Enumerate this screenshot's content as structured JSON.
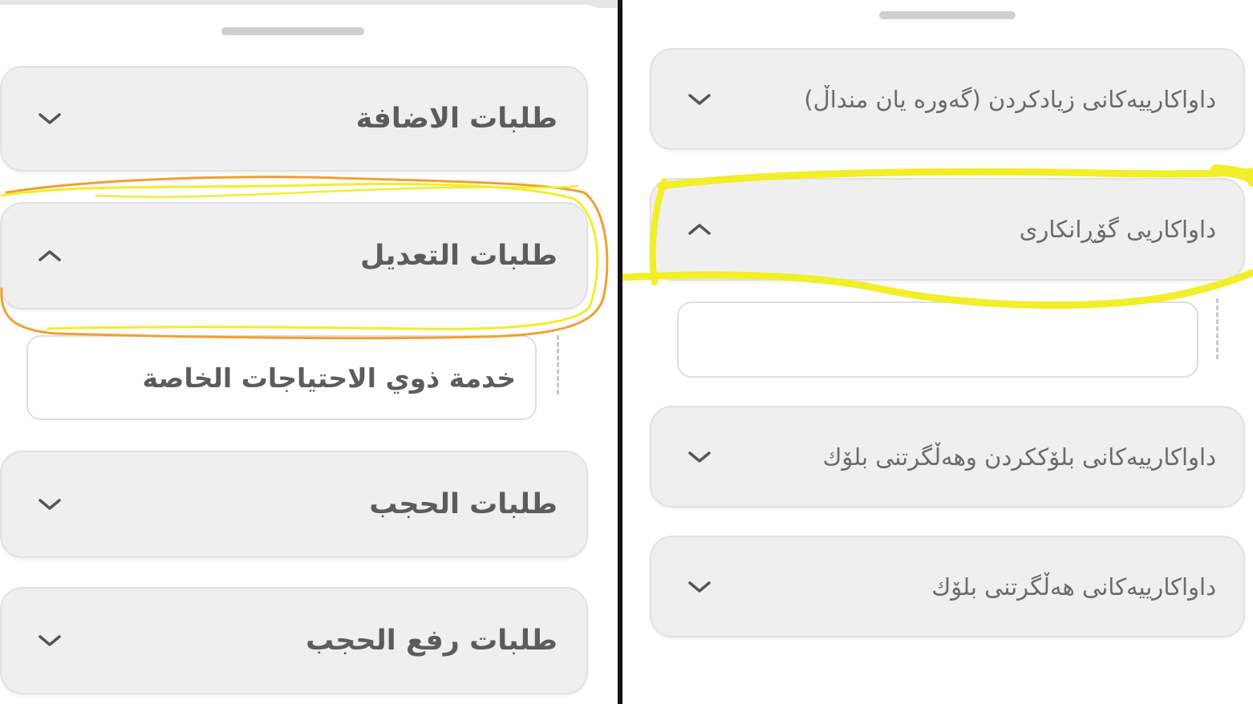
{
  "left": {
    "sections": [
      {
        "label": "طلبات الاضافة",
        "expanded": false
      },
      {
        "label": "طلبات التعديل",
        "expanded": true
      },
      {
        "label": "طلبات الحجب",
        "expanded": false
      },
      {
        "label": "طلبات رفع الحجب",
        "expanded": false
      }
    ],
    "sub_item": "خدمة ذوي الاحتياجات الخاصة"
  },
  "right": {
    "sections": [
      {
        "label": "داواکارییەکانی زیادکردن (گەورە یان منداڵ)",
        "expanded": false
      },
      {
        "label": "داواکاریی گۆڕانکاری",
        "expanded": true
      },
      {
        "label": "داواکارییەکانی بلۆککردن وهەڵگرتنی بلۆك",
        "expanded": false
      },
      {
        "label": "داواکارییەکانی هەڵگرتنی بلۆك",
        "expanded": false
      }
    ],
    "sub_item": ""
  },
  "icons": {
    "expanded": "chevron-up-icon",
    "collapsed": "chevron-down-icon"
  },
  "colors": {
    "highlight_yellow": "#f2ee2a",
    "highlight_orange": "#f0a030",
    "card_bg": "#efeff0",
    "text": "#5c5c5c"
  }
}
